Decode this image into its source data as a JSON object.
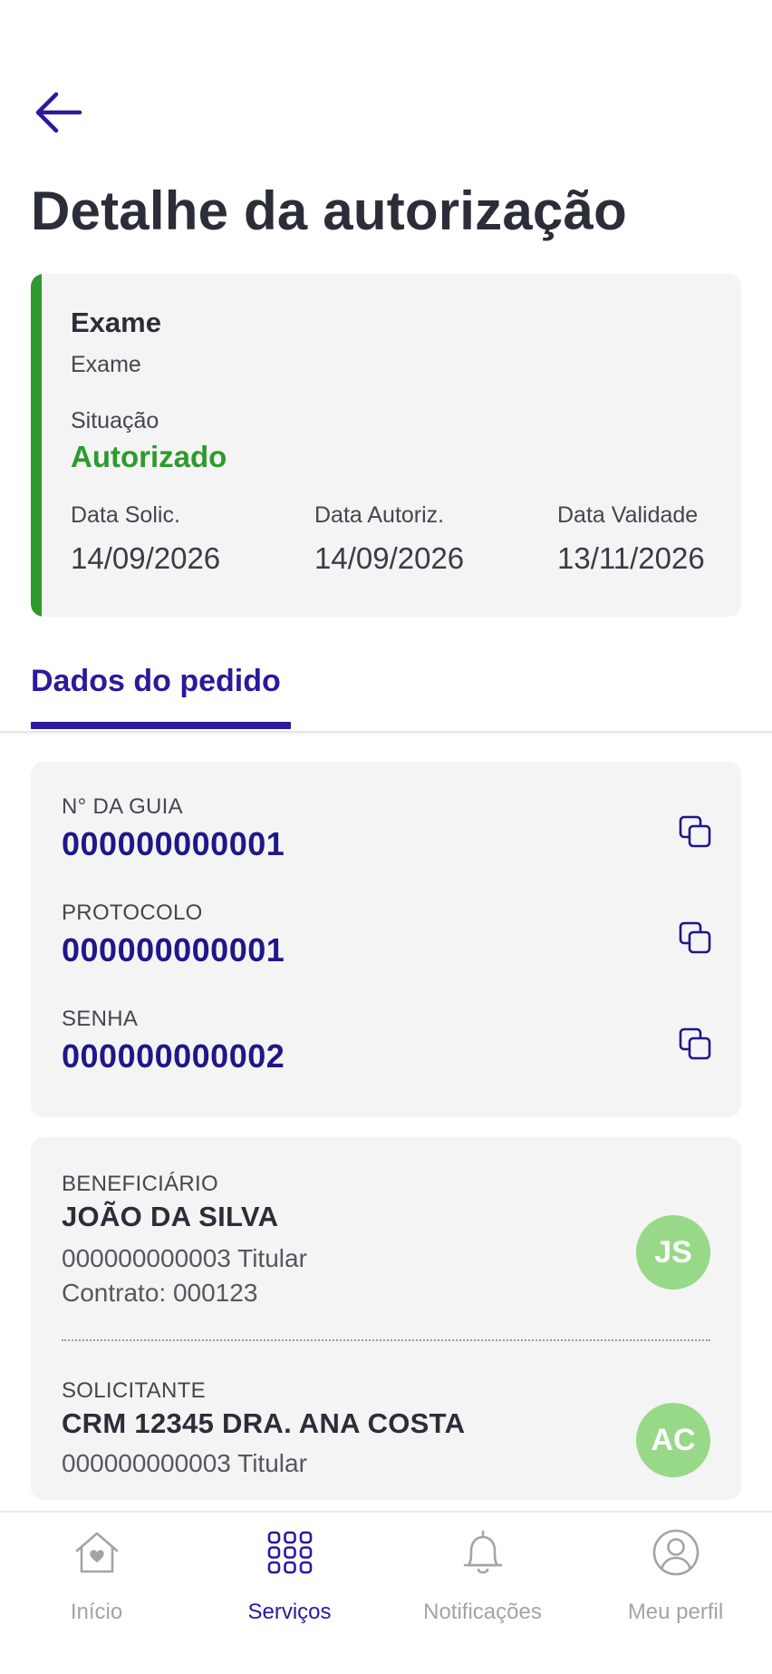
{
  "header": {
    "title": "Detalhe da autorização"
  },
  "summary": {
    "type": "Exame",
    "subtype": "Exame",
    "situation_label": "Situação",
    "situation_value": "Autorizado",
    "dates": [
      {
        "label": "Data Solic.",
        "value": "14/09/2026"
      },
      {
        "label": "Data Autoriz.",
        "value": "14/09/2026"
      },
      {
        "label": "Data Validade",
        "value": "13/11/2026"
      }
    ]
  },
  "tabs": [
    {
      "label": "Dados do pedido"
    }
  ],
  "identifiers": [
    {
      "label": "N° DA GUIA",
      "value": "000000000001"
    },
    {
      "label": "PROTOCOLO",
      "value": "000000000001"
    },
    {
      "label": "SENHA",
      "value": "000000000002"
    }
  ],
  "beneficiary": {
    "label": "BENEFICIÁRIO",
    "name": "JOÃO DA SILVA",
    "line1": "000000000003 Titular",
    "line2": "Contrato: 000123",
    "initials": "JS"
  },
  "requester": {
    "label": "SOLICITANTE",
    "name": "CRM 12345 DRA. ANA COSTA",
    "line1": "000000000003 Titular",
    "initials": "AC"
  },
  "nav": [
    {
      "label": "Início",
      "icon": "home-heart-icon"
    },
    {
      "label": "Serviços",
      "icon": "grid-icon"
    },
    {
      "label": "Notificações",
      "icon": "bell-icon"
    },
    {
      "label": "Meu perfil",
      "icon": "user-icon"
    }
  ],
  "colors": {
    "primary": "#2a1a9c",
    "success": "#2e9a2e",
    "avatar": "#97d988",
    "card_bg": "#f4f4f4"
  }
}
